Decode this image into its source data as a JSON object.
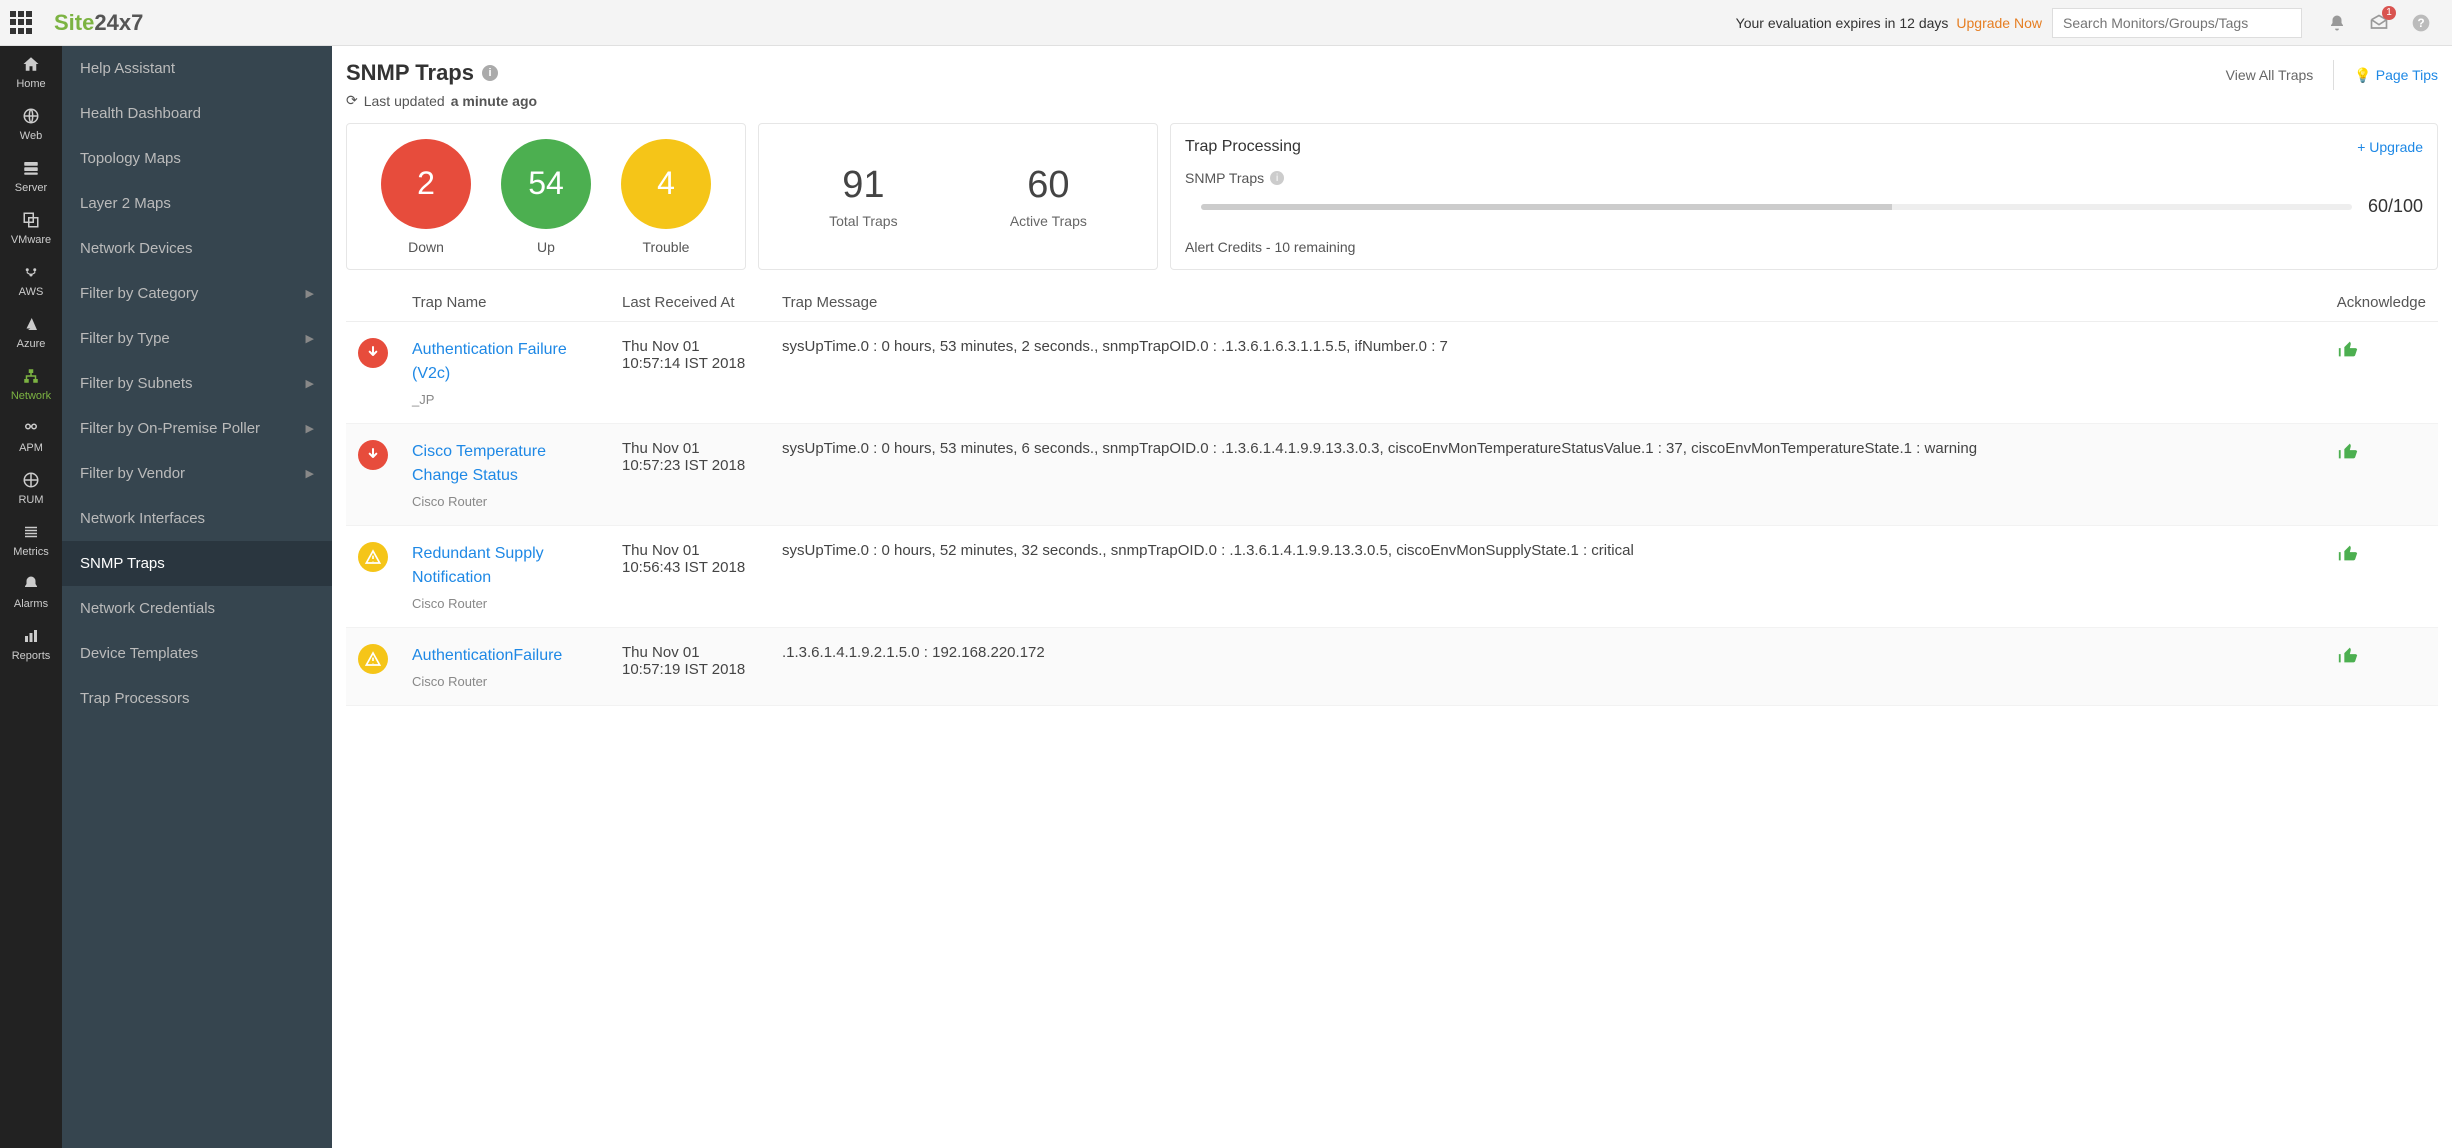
{
  "logo": {
    "part1": "Site",
    "part2": "24x7"
  },
  "top": {
    "eval_text": "Your evaluation expires in 12 days",
    "upgrade": "Upgrade Now",
    "search_placeholder": "Search Monitors/Groups/Tags",
    "badge": "1"
  },
  "rail": [
    {
      "label": "Home"
    },
    {
      "label": "Web"
    },
    {
      "label": "Server"
    },
    {
      "label": "VMware"
    },
    {
      "label": "AWS"
    },
    {
      "label": "Azure"
    },
    {
      "label": "Network",
      "active": true
    },
    {
      "label": "APM"
    },
    {
      "label": "RUM"
    },
    {
      "label": "Metrics"
    },
    {
      "label": "Alarms"
    },
    {
      "label": "Reports"
    }
  ],
  "menu": [
    {
      "label": "Help Assistant"
    },
    {
      "label": "Health Dashboard"
    },
    {
      "label": "Topology Maps"
    },
    {
      "label": "Layer 2 Maps"
    },
    {
      "label": "Network Devices"
    },
    {
      "label": "Filter by Category",
      "chev": true
    },
    {
      "label": "Filter by Type",
      "chev": true
    },
    {
      "label": "Filter by Subnets",
      "chev": true
    },
    {
      "label": "Filter by On-Premise Poller",
      "chev": true
    },
    {
      "label": "Filter by Vendor",
      "chev": true
    },
    {
      "label": "Network Interfaces"
    },
    {
      "label": "SNMP Traps",
      "active": true
    },
    {
      "label": "Network Credentials"
    },
    {
      "label": "Device Templates"
    },
    {
      "label": "Trap Processors"
    }
  ],
  "page": {
    "title": "SNMP Traps",
    "last_updated_prefix": "Last updated ",
    "last_updated_time": "a minute ago",
    "view_all": "View All Traps",
    "page_tips": "Page Tips"
  },
  "status": {
    "down": {
      "value": "2",
      "label": "Down"
    },
    "up": {
      "value": "54",
      "label": "Up"
    },
    "trouble": {
      "value": "4",
      "label": "Trouble"
    }
  },
  "totals": {
    "total": {
      "value": "91",
      "label": "Total Traps"
    },
    "active": {
      "value": "60",
      "label": "Active Traps"
    }
  },
  "proc": {
    "title": "Trap Processing",
    "upgrade": "+ Upgrade",
    "label": "SNMP Traps",
    "value": "60/100",
    "credits": "Alert Credits - 10 remaining"
  },
  "columns": {
    "name": "Trap Name",
    "time": "Last Received At",
    "msg": "Trap Message",
    "ack": "Acknowledge"
  },
  "rows": [
    {
      "status": "down",
      "name": "Authentication Failure (V2c)",
      "source": "_JP",
      "time": "Thu Nov 01 10:57:14 IST 2018",
      "msg": "sysUpTime.0 : 0 hours, 53 minutes, 2 seconds., snmpTrapOID.0 : .1.3.6.1.6.3.1.1.5.5, ifNumber.0 : 7"
    },
    {
      "status": "down",
      "name": "Cisco Temperature Change Status",
      "source": "Cisco Router",
      "time": "Thu Nov 01 10:57:23 IST 2018",
      "msg": "sysUpTime.0 : 0 hours, 53 minutes, 6 seconds., snmpTrapOID.0 : .1.3.6.1.4.1.9.9.13.3.0.3, ciscoEnvMonTemperatureStatusValue.1 : 37, ciscoEnvMonTemperatureState.1 : warning"
    },
    {
      "status": "trouble",
      "name": "Redundant Supply Notification",
      "source": "Cisco Router",
      "time": "Thu Nov 01 10:56:43 IST 2018",
      "msg": "sysUpTime.0 : 0 hours, 52 minutes, 32 seconds., snmpTrapOID.0 : .1.3.6.1.4.1.9.9.13.3.0.5, ciscoEnvMonSupplyState.1 : critical"
    },
    {
      "status": "trouble",
      "name": "AuthenticationFailure",
      "source": "Cisco Router",
      "time": "Thu Nov 01 10:57:19 IST 2018",
      "msg": ".1.3.6.1.4.1.9.2.1.5.0 : 192.168.220.172"
    }
  ]
}
